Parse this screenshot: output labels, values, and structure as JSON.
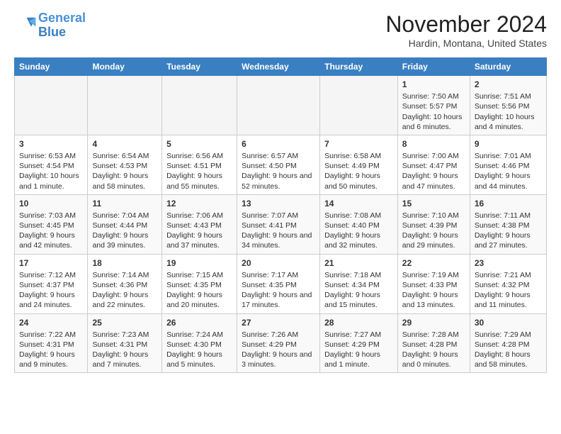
{
  "logo": {
    "line1": "General",
    "line2": "Blue"
  },
  "title": "November 2024",
  "location": "Hardin, Montana, United States",
  "days_of_week": [
    "Sunday",
    "Monday",
    "Tuesday",
    "Wednesday",
    "Thursday",
    "Friday",
    "Saturday"
  ],
  "weeks": [
    [
      {
        "day": "",
        "info": ""
      },
      {
        "day": "",
        "info": ""
      },
      {
        "day": "",
        "info": ""
      },
      {
        "day": "",
        "info": ""
      },
      {
        "day": "",
        "info": ""
      },
      {
        "day": "1",
        "info": "Sunrise: 7:50 AM\nSunset: 5:57 PM\nDaylight: 10 hours and 6 minutes."
      },
      {
        "day": "2",
        "info": "Sunrise: 7:51 AM\nSunset: 5:56 PM\nDaylight: 10 hours and 4 minutes."
      }
    ],
    [
      {
        "day": "3",
        "info": "Sunrise: 6:53 AM\nSunset: 4:54 PM\nDaylight: 10 hours and 1 minute."
      },
      {
        "day": "4",
        "info": "Sunrise: 6:54 AM\nSunset: 4:53 PM\nDaylight: 9 hours and 58 minutes."
      },
      {
        "day": "5",
        "info": "Sunrise: 6:56 AM\nSunset: 4:51 PM\nDaylight: 9 hours and 55 minutes."
      },
      {
        "day": "6",
        "info": "Sunrise: 6:57 AM\nSunset: 4:50 PM\nDaylight: 9 hours and 52 minutes."
      },
      {
        "day": "7",
        "info": "Sunrise: 6:58 AM\nSunset: 4:49 PM\nDaylight: 9 hours and 50 minutes."
      },
      {
        "day": "8",
        "info": "Sunrise: 7:00 AM\nSunset: 4:47 PM\nDaylight: 9 hours and 47 minutes."
      },
      {
        "day": "9",
        "info": "Sunrise: 7:01 AM\nSunset: 4:46 PM\nDaylight: 9 hours and 44 minutes."
      }
    ],
    [
      {
        "day": "10",
        "info": "Sunrise: 7:03 AM\nSunset: 4:45 PM\nDaylight: 9 hours and 42 minutes."
      },
      {
        "day": "11",
        "info": "Sunrise: 7:04 AM\nSunset: 4:44 PM\nDaylight: 9 hours and 39 minutes."
      },
      {
        "day": "12",
        "info": "Sunrise: 7:06 AM\nSunset: 4:43 PM\nDaylight: 9 hours and 37 minutes."
      },
      {
        "day": "13",
        "info": "Sunrise: 7:07 AM\nSunset: 4:41 PM\nDaylight: 9 hours and 34 minutes."
      },
      {
        "day": "14",
        "info": "Sunrise: 7:08 AM\nSunset: 4:40 PM\nDaylight: 9 hours and 32 minutes."
      },
      {
        "day": "15",
        "info": "Sunrise: 7:10 AM\nSunset: 4:39 PM\nDaylight: 9 hours and 29 minutes."
      },
      {
        "day": "16",
        "info": "Sunrise: 7:11 AM\nSunset: 4:38 PM\nDaylight: 9 hours and 27 minutes."
      }
    ],
    [
      {
        "day": "17",
        "info": "Sunrise: 7:12 AM\nSunset: 4:37 PM\nDaylight: 9 hours and 24 minutes."
      },
      {
        "day": "18",
        "info": "Sunrise: 7:14 AM\nSunset: 4:36 PM\nDaylight: 9 hours and 22 minutes."
      },
      {
        "day": "19",
        "info": "Sunrise: 7:15 AM\nSunset: 4:35 PM\nDaylight: 9 hours and 20 minutes."
      },
      {
        "day": "20",
        "info": "Sunrise: 7:17 AM\nSunset: 4:35 PM\nDaylight: 9 hours and 17 minutes."
      },
      {
        "day": "21",
        "info": "Sunrise: 7:18 AM\nSunset: 4:34 PM\nDaylight: 9 hours and 15 minutes."
      },
      {
        "day": "22",
        "info": "Sunrise: 7:19 AM\nSunset: 4:33 PM\nDaylight: 9 hours and 13 minutes."
      },
      {
        "day": "23",
        "info": "Sunrise: 7:21 AM\nSunset: 4:32 PM\nDaylight: 9 hours and 11 minutes."
      }
    ],
    [
      {
        "day": "24",
        "info": "Sunrise: 7:22 AM\nSunset: 4:31 PM\nDaylight: 9 hours and 9 minutes."
      },
      {
        "day": "25",
        "info": "Sunrise: 7:23 AM\nSunset: 4:31 PM\nDaylight: 9 hours and 7 minutes."
      },
      {
        "day": "26",
        "info": "Sunrise: 7:24 AM\nSunset: 4:30 PM\nDaylight: 9 hours and 5 minutes."
      },
      {
        "day": "27",
        "info": "Sunrise: 7:26 AM\nSunset: 4:29 PM\nDaylight: 9 hours and 3 minutes."
      },
      {
        "day": "28",
        "info": "Sunrise: 7:27 AM\nSunset: 4:29 PM\nDaylight: 9 hours and 1 minute."
      },
      {
        "day": "29",
        "info": "Sunrise: 7:28 AM\nSunset: 4:28 PM\nDaylight: 9 hours and 0 minutes."
      },
      {
        "day": "30",
        "info": "Sunrise: 7:29 AM\nSunset: 4:28 PM\nDaylight: 8 hours and 58 minutes."
      }
    ]
  ]
}
